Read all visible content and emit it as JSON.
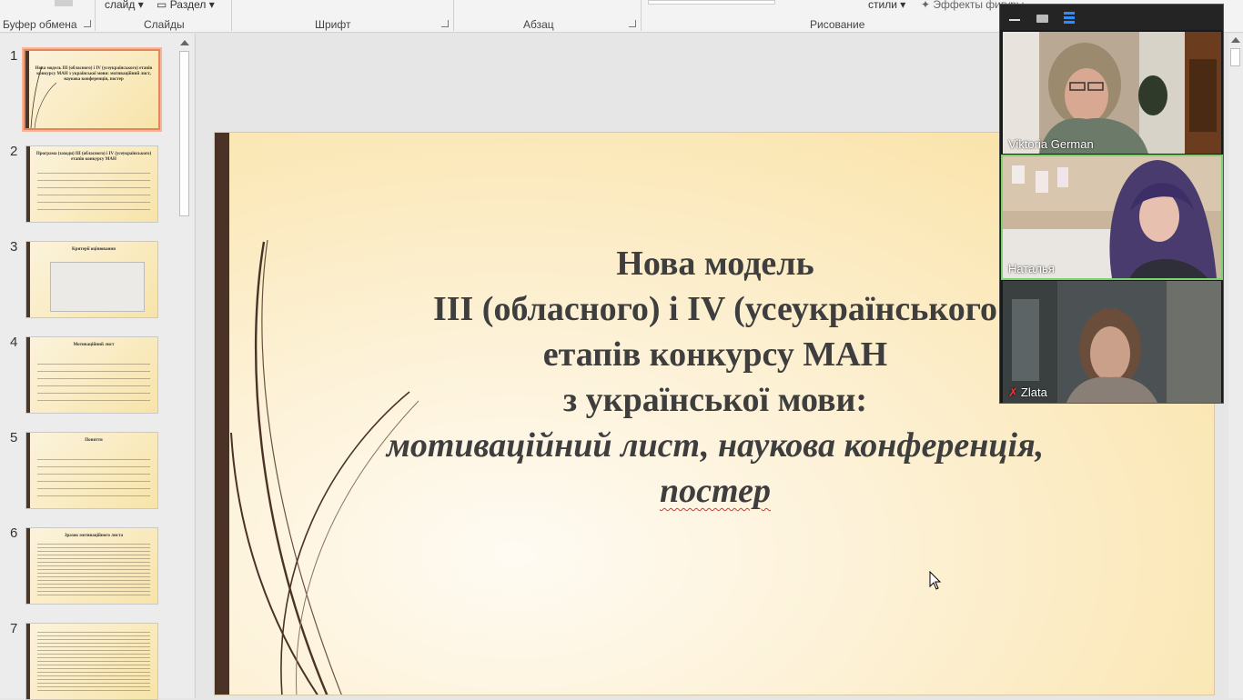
{
  "ribbon": {
    "groups": {
      "clipboard": "Буфер обмена",
      "slides": "Слайды",
      "font": "Шрифт",
      "paragraph": "Абзац",
      "drawing": "Рисование"
    },
    "controls": {
      "slide_label": "слайд",
      "section_label": "Раздел",
      "styles_label": "стили",
      "effects_label": "Эффекты фигуры"
    }
  },
  "thumbnails": [
    {
      "number": "1",
      "title": "Нова модель III (обласного) і IV (усеукраїнського) етапів конкурсу МАН з української мови: мотиваційний лист, наукова конференція, постер",
      "active": true
    },
    {
      "number": "2",
      "title": "Програма (заходи) ІІІ (обласного) і IV (усеукраїнського) етапів конкурсу МАН",
      "active": false
    },
    {
      "number": "3",
      "title": "Критерії оцінювання",
      "active": false
    },
    {
      "number": "4",
      "title": "Мотиваційний лист",
      "active": false
    },
    {
      "number": "5",
      "title": "Поняття",
      "active": false
    },
    {
      "number": "6",
      "title": "Зразок мотиваційного листа",
      "active": false
    },
    {
      "number": "7",
      "title": "",
      "active": false
    }
  ],
  "slide": {
    "line1": "Нова модель",
    "line2": "ІІІ (обласного) і IV (усеукраїнського",
    "line3": "етапів конкурсу МАН",
    "line4": "з української мови:",
    "line5": "мотиваційний лист, наукова конференція,",
    "line6": "постер"
  },
  "participants": [
    {
      "name": "Viktoria German",
      "muted": false,
      "active": false
    },
    {
      "name": "Наталья",
      "muted": false,
      "active": true
    },
    {
      "name": "Zlata",
      "muted": true,
      "active": false
    }
  ],
  "colors": {
    "accent_selected": "#e8845b",
    "slide_bar": "#4a3326",
    "active_speaker": "#7bd36f",
    "zoom_blue": "#2e8cff"
  }
}
